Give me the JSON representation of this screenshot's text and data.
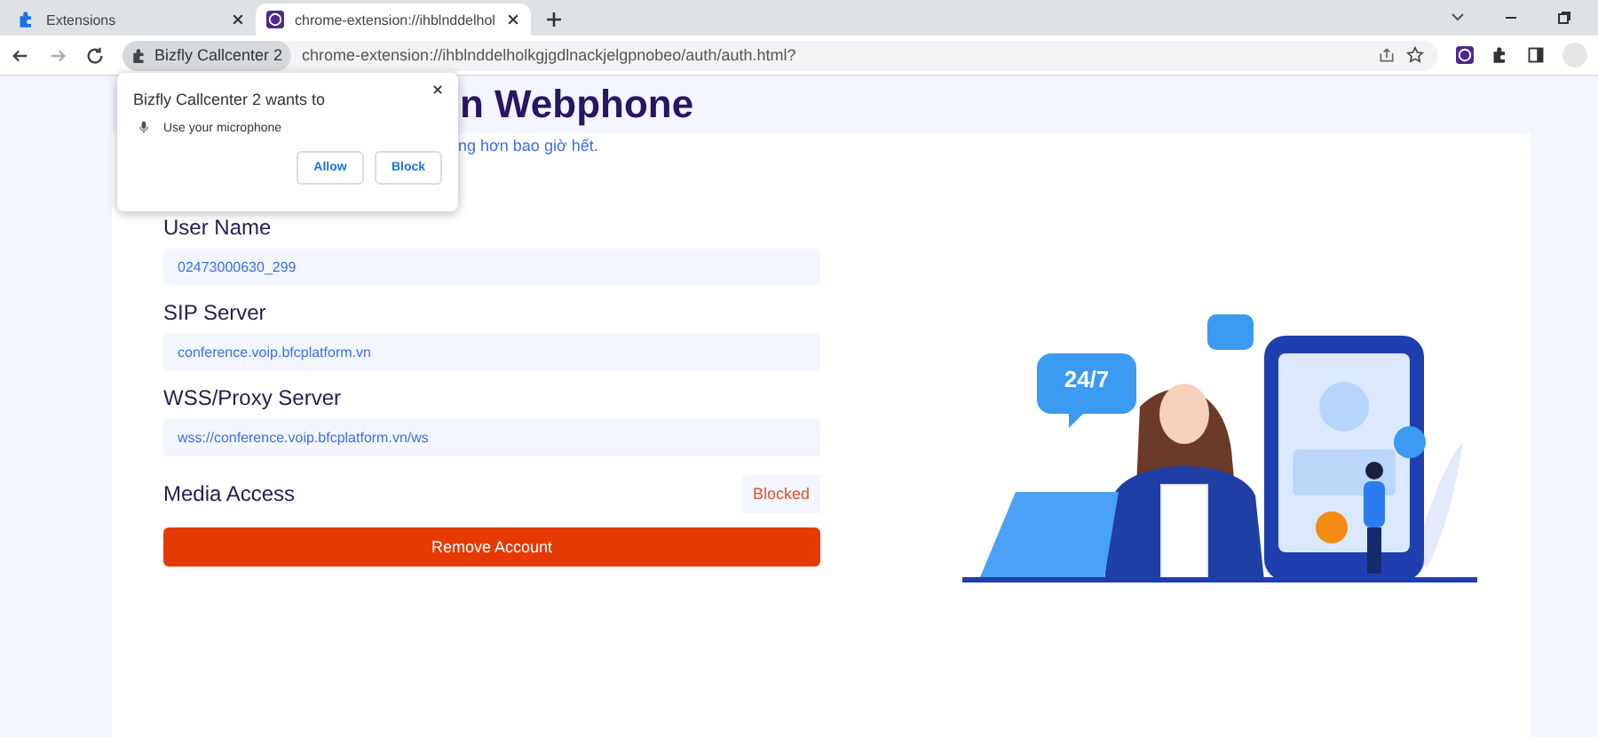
{
  "tabs": [
    {
      "label": "Extensions",
      "selected": false
    },
    {
      "label": "chrome-extension://ihblnddelhol",
      "selected": true
    }
  ],
  "address_bar": {
    "chip": "Bizfly Callcenter 2",
    "url": "chrome-extension://ihblnddelholkgjgdlnackjelgpnobeo/auth/auth.html?"
  },
  "page": {
    "title": "n Webphone",
    "subtitle": "ng hơn bao giờ hết.",
    "fields": [
      {
        "label": "User Name",
        "value": "02473000630_299"
      },
      {
        "label": "SIP Server",
        "value": "conference.voip.bfcplatform.vn"
      },
      {
        "label": "WSS/Proxy Server",
        "value": "wss://conference.voip.bfcplatform.vn/ws"
      }
    ],
    "media_access": {
      "label": "Media Access",
      "status": "Blocked"
    },
    "remove_button": "Remove Account",
    "illustration": {
      "bubble_text": "24/7"
    }
  },
  "permission_popup": {
    "title": "Bizfly Callcenter 2 wants to",
    "permission": "Use your microphone",
    "buttons": [
      "Allow",
      "Block"
    ]
  }
}
